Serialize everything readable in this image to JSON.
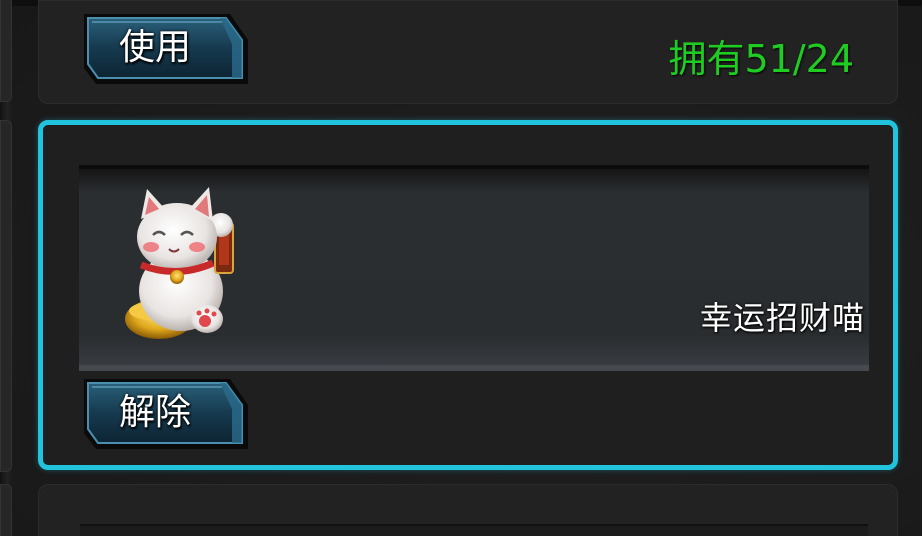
{
  "top_card": {
    "use_button_label": "使用",
    "owned_text": "拥有51/24",
    "owned_color": "#1fcd22"
  },
  "selected_card": {
    "item_name": "幸运招财喵",
    "item_icon": "lucky-cat-icon",
    "release_button_label": "解除",
    "highlight_color": "#22c3dc"
  }
}
